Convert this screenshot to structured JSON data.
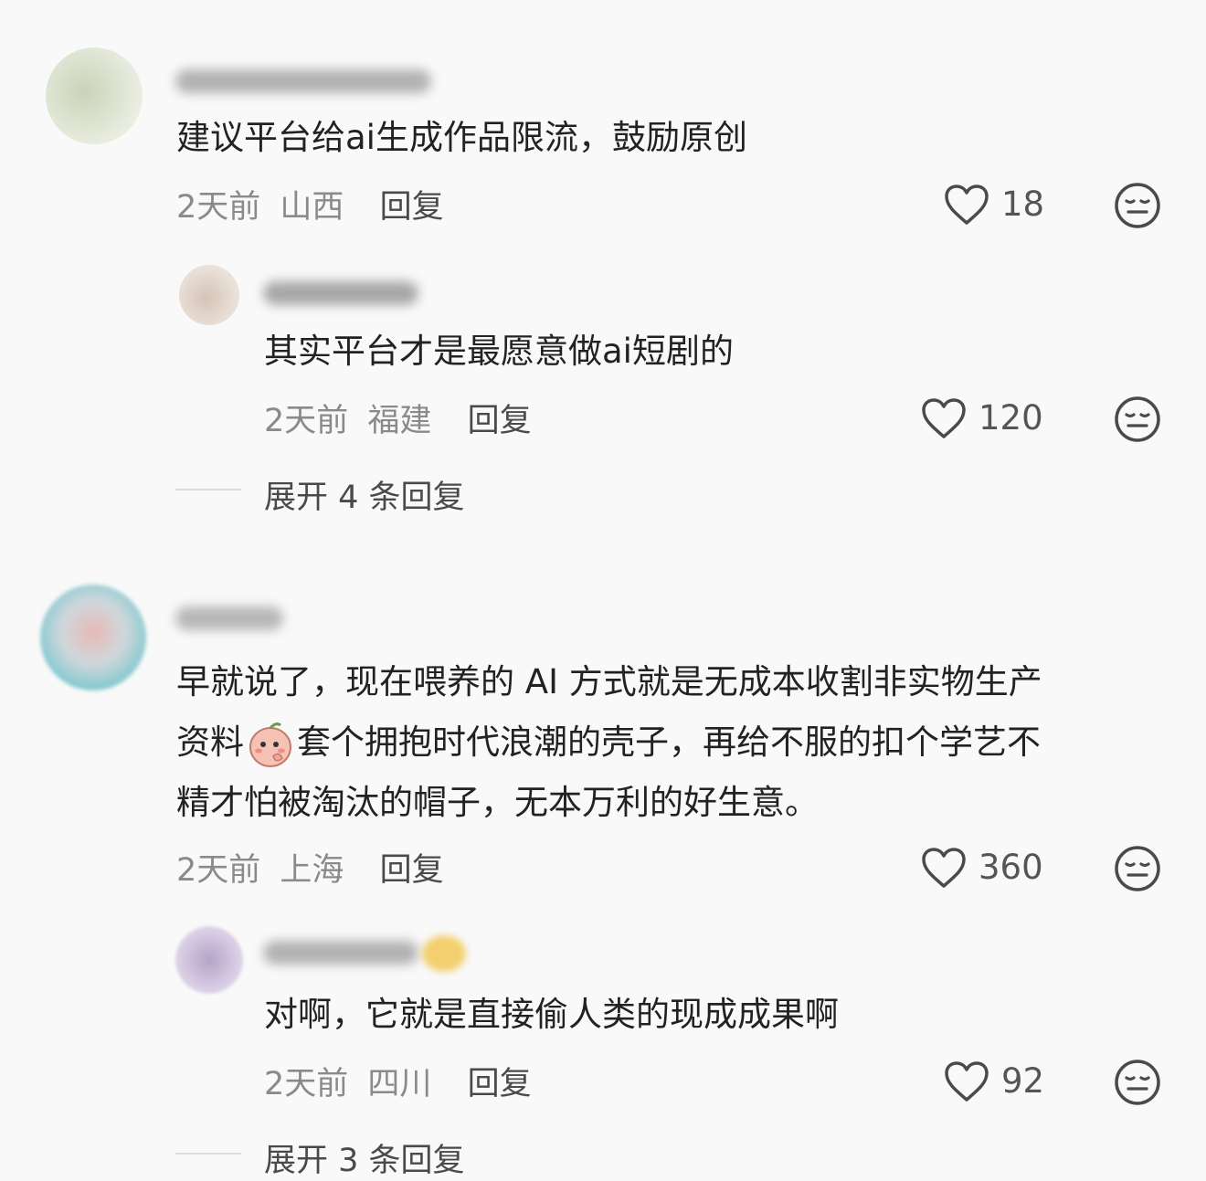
{
  "comments": [
    {
      "text_lines": [
        "建议平台给ai生成作品限流，鼓励原创"
      ],
      "time": "2天前",
      "location": "山西",
      "reply_label": "回复",
      "likes": "18"
    },
    {
      "text_lines": [
        "其实平台才是最愿意做ai短剧的"
      ],
      "time": "2天前",
      "location": "福建",
      "reply_label": "回复",
      "likes": "120",
      "expand_label": "展开 4 条回复"
    },
    {
      "text_lines": [
        "早就说了，现在喂养的 AI 方式就是无成本收割非实物生产",
        "资料",
        "套个拥抱时代浪潮的壳子，再给不服的扣个学艺不",
        "精才怕被淘汰的帽子，无本万利的好生意。"
      ],
      "time": "2天前",
      "location": "上海",
      "reply_label": "回复",
      "likes": "360"
    },
    {
      "text_lines": [
        "对啊，它就是直接偷人类的现成成果啊"
      ],
      "time": "2天前",
      "location": "四川",
      "reply_label": "回复",
      "likes": "92",
      "expand_label": "展开 3 条回复"
    }
  ],
  "icons": {
    "like": "heart-outline-icon",
    "dislike": "meh-face-icon",
    "inline_emoji": "shy-peach-emoji-icon"
  }
}
